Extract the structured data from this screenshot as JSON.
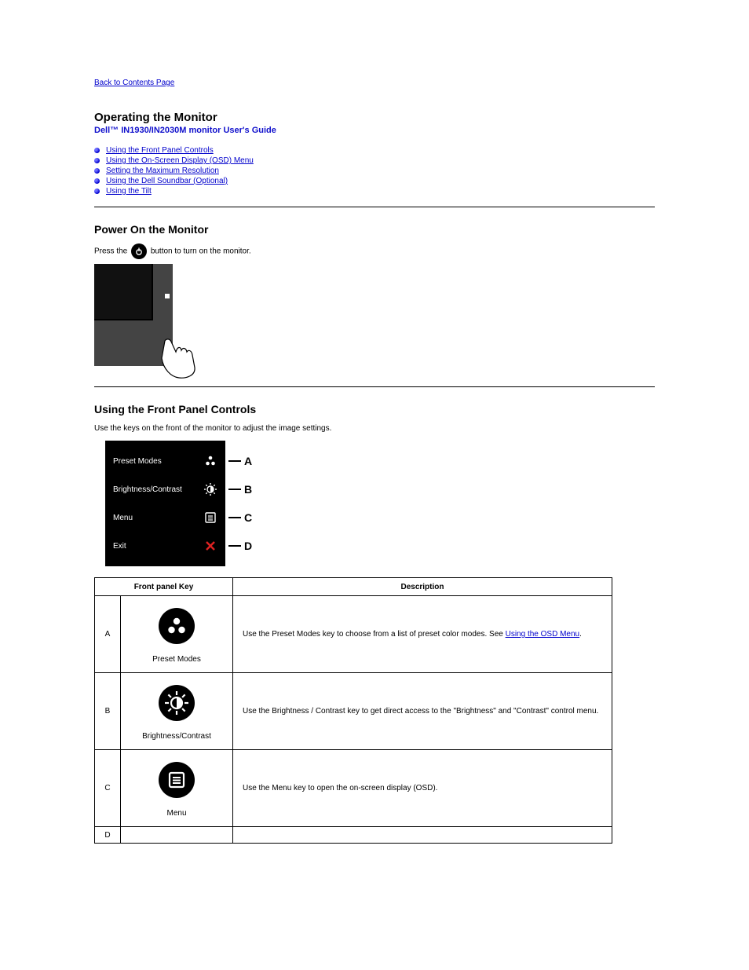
{
  "back": "Back to Contents Page",
  "title": "Operating the Monitor",
  "model": "Dell™ IN1930/IN2030M monitor User's Guide",
  "toc": [
    "Using the Front Panel Controls",
    "Using the On-Screen Display (OSD) Menu",
    "Setting the Maximum Resolution",
    "Using the Dell Soundbar (Optional)",
    "Using the Tilt"
  ],
  "section_power": "Power On the Monitor",
  "power_text_before": "Press the ",
  "power_text_after": " button to turn on the monitor.",
  "section_front": "Using the Front Panel Controls",
  "front_intro": "Use the keys on the front of the monitor to adjust the image settings.",
  "osd": {
    "row0": "Preset Modes",
    "row1": "Brightness/Contrast",
    "row2": "Menu",
    "row3": "Exit",
    "letters": {
      "a": "A",
      "b": "B",
      "c": "C",
      "d": "D"
    }
  },
  "table": {
    "head_col1": "Front panel Key",
    "head_col2": "Description",
    "rowA": {
      "letter": "A",
      "name": "Preset Modes",
      "desc_before": "Use the Preset Modes key to choose from a list of preset color modes. See ",
      "link": "Using the OSD Menu",
      "desc_after": "."
    },
    "rowB": {
      "letter": "B",
      "name": "Brightness/Contrast",
      "desc": "Use the Brightness / Contrast key to get direct access to the \"Brightness\" and \"Contrast\" control menu."
    },
    "rowC": {
      "letter": "C",
      "name": "Menu",
      "desc": "Use the Menu key to open the on-screen display (OSD)."
    },
    "rowD": {
      "letter": "D"
    }
  }
}
